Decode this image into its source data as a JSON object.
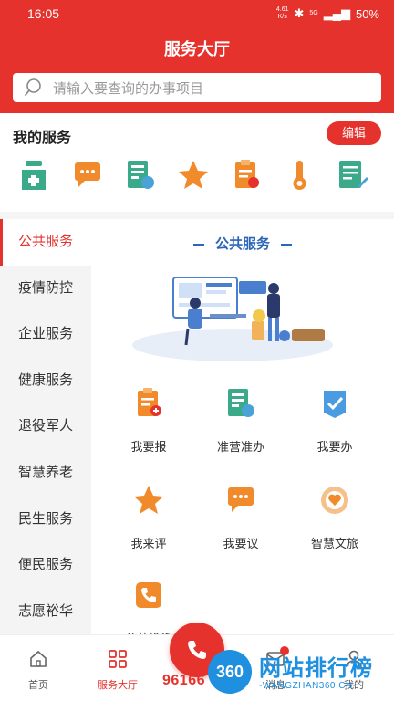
{
  "status_bar": {
    "time": "16:05",
    "net_speed_top": "4.61",
    "net_speed_bottom": "K/s",
    "signal": "5G",
    "battery": "50%"
  },
  "header": {
    "title": "服务大厅"
  },
  "search": {
    "placeholder": "请输入要查询的办事项目"
  },
  "my_services": {
    "title": "我的服务",
    "edit_label": "编辑",
    "icons": [
      "medicine-icon",
      "chat-icon",
      "license-icon",
      "star-icon",
      "clipboard-icon",
      "thermometer-icon",
      "document-edit-icon"
    ]
  },
  "sidebar": {
    "items": [
      {
        "label": "公共服务"
      },
      {
        "label": "疫情防控"
      },
      {
        "label": "企业服务"
      },
      {
        "label": "健康服务"
      },
      {
        "label": "退役军人"
      },
      {
        "label": "智慧养老"
      },
      {
        "label": "民生服务"
      },
      {
        "label": "便民服务"
      },
      {
        "label": "志愿裕华"
      }
    ]
  },
  "main": {
    "section_title": "公共服务",
    "grid": [
      {
        "label": "我要报",
        "icon": "clipboard-add-icon"
      },
      {
        "label": "准营准办",
        "icon": "license-icon"
      },
      {
        "label": "我要办",
        "icon": "task-check-icon"
      },
      {
        "label": "我来评",
        "icon": "star-icon"
      },
      {
        "label": "我要议",
        "icon": "chat-icon"
      },
      {
        "label": "智慧文旅",
        "icon": "heart-circle-icon"
      },
      {
        "label": "公共投诉",
        "icon": "phone-icon"
      }
    ]
  },
  "tabbar": {
    "items": [
      {
        "label": "首页",
        "icon": "home-icon"
      },
      {
        "label": "服务大厅",
        "icon": "grid-icon"
      },
      {
        "label": "消息",
        "icon": "message-icon"
      },
      {
        "label": "我的",
        "icon": "user-icon"
      }
    ],
    "hotline": "96166"
  },
  "watermark": {
    "logo": "360",
    "title": "网站排行榜",
    "url": "-WANGZHAN360.CN-"
  },
  "colors": {
    "brand": "#e5322d",
    "accent_blue": "#2b66b8",
    "icon_teal": "#3aaa8a",
    "icon_orange": "#f08a2a"
  }
}
